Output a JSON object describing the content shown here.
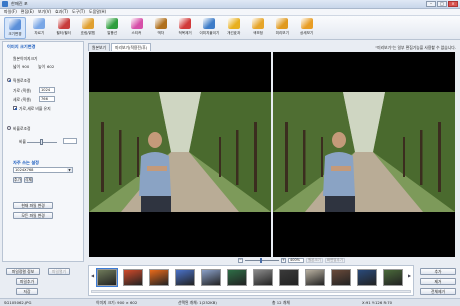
{
  "window": {
    "title": "한매진 포"
  },
  "menu": [
    "파일(F)",
    "편집(E)",
    "보기(V)",
    "효과(T)",
    "도구(T)",
    "도움말(H)"
  ],
  "toolbar": [
    {
      "label": "크기변경",
      "icon": "resize-icon",
      "color": "#5b8fd9"
    },
    {
      "label": "자르기",
      "icon": "crop-icon",
      "color": "#7aa7e6"
    },
    {
      "label": "필터/필터",
      "icon": "filter-icon",
      "color": "#c83c3c"
    },
    {
      "label": "흐림/밝힘",
      "icon": "brightness-icon",
      "color": "#e0a030"
    },
    {
      "label": "말풍선",
      "icon": "speech-bubble-icon",
      "color": "#2e9e3e"
    },
    {
      "label": "스티커",
      "icon": "sticker-icon",
      "color": "#d64fa8"
    },
    {
      "label": "액자",
      "icon": "frame-icon",
      "color": "#b0701e"
    },
    {
      "label": "적목제거",
      "icon": "redeye-icon",
      "color": "#d13a3a"
    },
    {
      "label": "이미지붙이기",
      "icon": "paste-image-icon",
      "color": "#3e7cc8"
    },
    {
      "label": "개선효과",
      "icon": "enhance-icon",
      "color": "#e8b020"
    },
    {
      "label": "색보정",
      "icon": "color-correct-icon",
      "color": "#e6a52a"
    },
    {
      "label": "미리보기",
      "icon": "preview-icon",
      "color": "#e09a20"
    },
    {
      "label": "상세보기",
      "icon": "detail-icon",
      "color": "#e89d25"
    }
  ],
  "left": {
    "section_size": "이미지 크기변경",
    "orig_label": "원본이미지크기",
    "orig_w_label": "넓이",
    "orig_w": "900",
    "orig_h_label": "높이",
    "orig_h": "602",
    "pixel_mode": "픽셀로조정",
    "width_label": "가로 (픽셀)",
    "width_val": "1024",
    "height_label": "세로 (픽셀)",
    "height_val": "766",
    "keep_ratio": "가로,세로 비율 유지",
    "percent_mode": "비율로조정",
    "ratio_label": "비율",
    "recent_title": "자주 쓰는 설정",
    "recent_value": "1024X768",
    "btn_add": "추가",
    "btn_del": "삭제",
    "btn_apply_current": "현재 파일 변경",
    "btn_apply_all": "모든 파일 변경"
  },
  "tabs": [
    "원본보기",
    "미리보기(적용전/후)"
  ],
  "notice": "\"미리보기\"는 일부 편집기능을 사용할 수 없습니다.",
  "zoom": {
    "value": "400%",
    "fit_label": "원본크기",
    "full_label": "화면맞추기"
  },
  "bottom_left": {
    "btn_sort": "파일정렬 정보",
    "btn_open": "파일열기",
    "btn_addfile": "파일추가",
    "btn_save": "저장"
  },
  "right_buttons": [
    "추가",
    "제거",
    "전체제거"
  ],
  "thumb_colors": [
    "#6f7a5a",
    "#d04a2a",
    "#e96a1a",
    "#4a72c8",
    "#8aa0c8",
    "#2e6e46",
    "#8a8a8a",
    "#3a3a3a",
    "#b8b0a0",
    "#6a4a3a",
    "#2a4a7a",
    "#4a6a3a"
  ],
  "status": {
    "file": "SG105062.JPG",
    "size": "이미지 크기: 900 × 602",
    "selected": "선택된 개체: 1(252KB)",
    "count": "총 12 개체",
    "coords": "X:91 Y:126 R:70"
  }
}
